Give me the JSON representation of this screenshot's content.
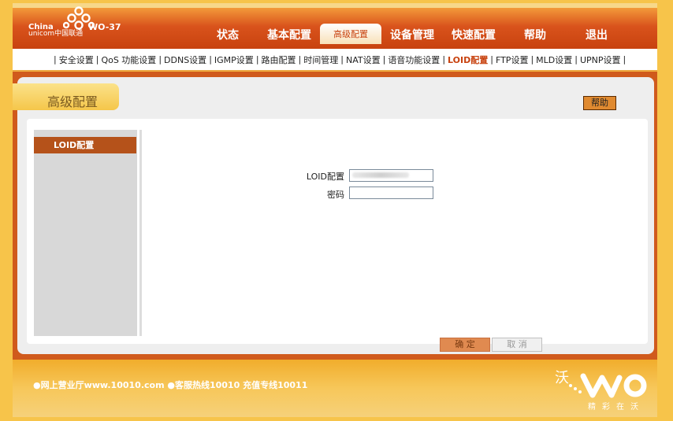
{
  "header": {
    "brand_china": "China",
    "brand_unicom": "unicom中国联通",
    "model": "WO-37",
    "tabs": [
      {
        "label": "状态"
      },
      {
        "label": "基本配置"
      },
      {
        "label": "高级配置"
      },
      {
        "label": "设备管理"
      },
      {
        "label": "快速配置"
      },
      {
        "label": "帮助"
      },
      {
        "label": "退出"
      }
    ],
    "active_tab": "高级配置"
  },
  "subnav": {
    "items": [
      {
        "label": "安全设置"
      },
      {
        "label": "QoS 功能设置"
      },
      {
        "label": "DDNS设置"
      },
      {
        "label": "IGMP设置"
      },
      {
        "label": "路由配置"
      },
      {
        "label": "时间管理"
      },
      {
        "label": "NAT设置"
      },
      {
        "label": "语音功能设置"
      },
      {
        "label": "LOID配置"
      },
      {
        "label": "FTP设置"
      },
      {
        "label": "MLD设置"
      },
      {
        "label": "UPNP设置"
      }
    ],
    "active": "LOID配置",
    "separator": "|"
  },
  "page": {
    "title": "高级配置",
    "help_label": "帮助"
  },
  "sidebar": {
    "items": [
      {
        "label": "LOID配置"
      }
    ]
  },
  "form": {
    "loid_label": "LOID配置",
    "loid_value": "",
    "password_label": "密码",
    "password_value": "",
    "confirm_label": "确 定",
    "cancel_label": "取 消"
  },
  "footer": {
    "text": "●网上营业厅www.10010.com ●客服热线10010 充值专线10011",
    "brand": "沃",
    "slogan": "精彩在沃"
  },
  "colors": {
    "header_accent": "#c8420f",
    "footer_bg": "#f3b23a",
    "sidebar_active": "#b5521a"
  }
}
